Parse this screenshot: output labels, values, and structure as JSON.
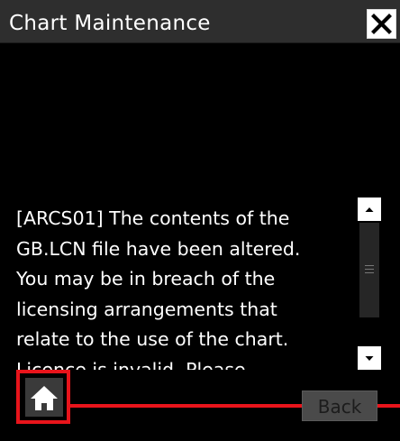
{
  "window": {
    "title": "Chart Maintenance",
    "close_icon": "close-icon"
  },
  "message": {
    "lines": [
      "[ARCS01] The contents of the",
      "GB.LCN file have been altered.",
      "You may be in breach of the",
      "licensing arrangements that",
      "relate to the use of the chart.",
      "Licence is invalid. Please"
    ]
  },
  "scrollbar": {
    "up_icon": "triangle-up-icon",
    "down_icon": "triangle-down-icon"
  },
  "footer": {
    "home_icon": "home-icon",
    "back_label": "Back"
  },
  "colors": {
    "titlebar_bg": "#2e2e2e",
    "highlight": "#e8141b",
    "background": "#000000"
  }
}
